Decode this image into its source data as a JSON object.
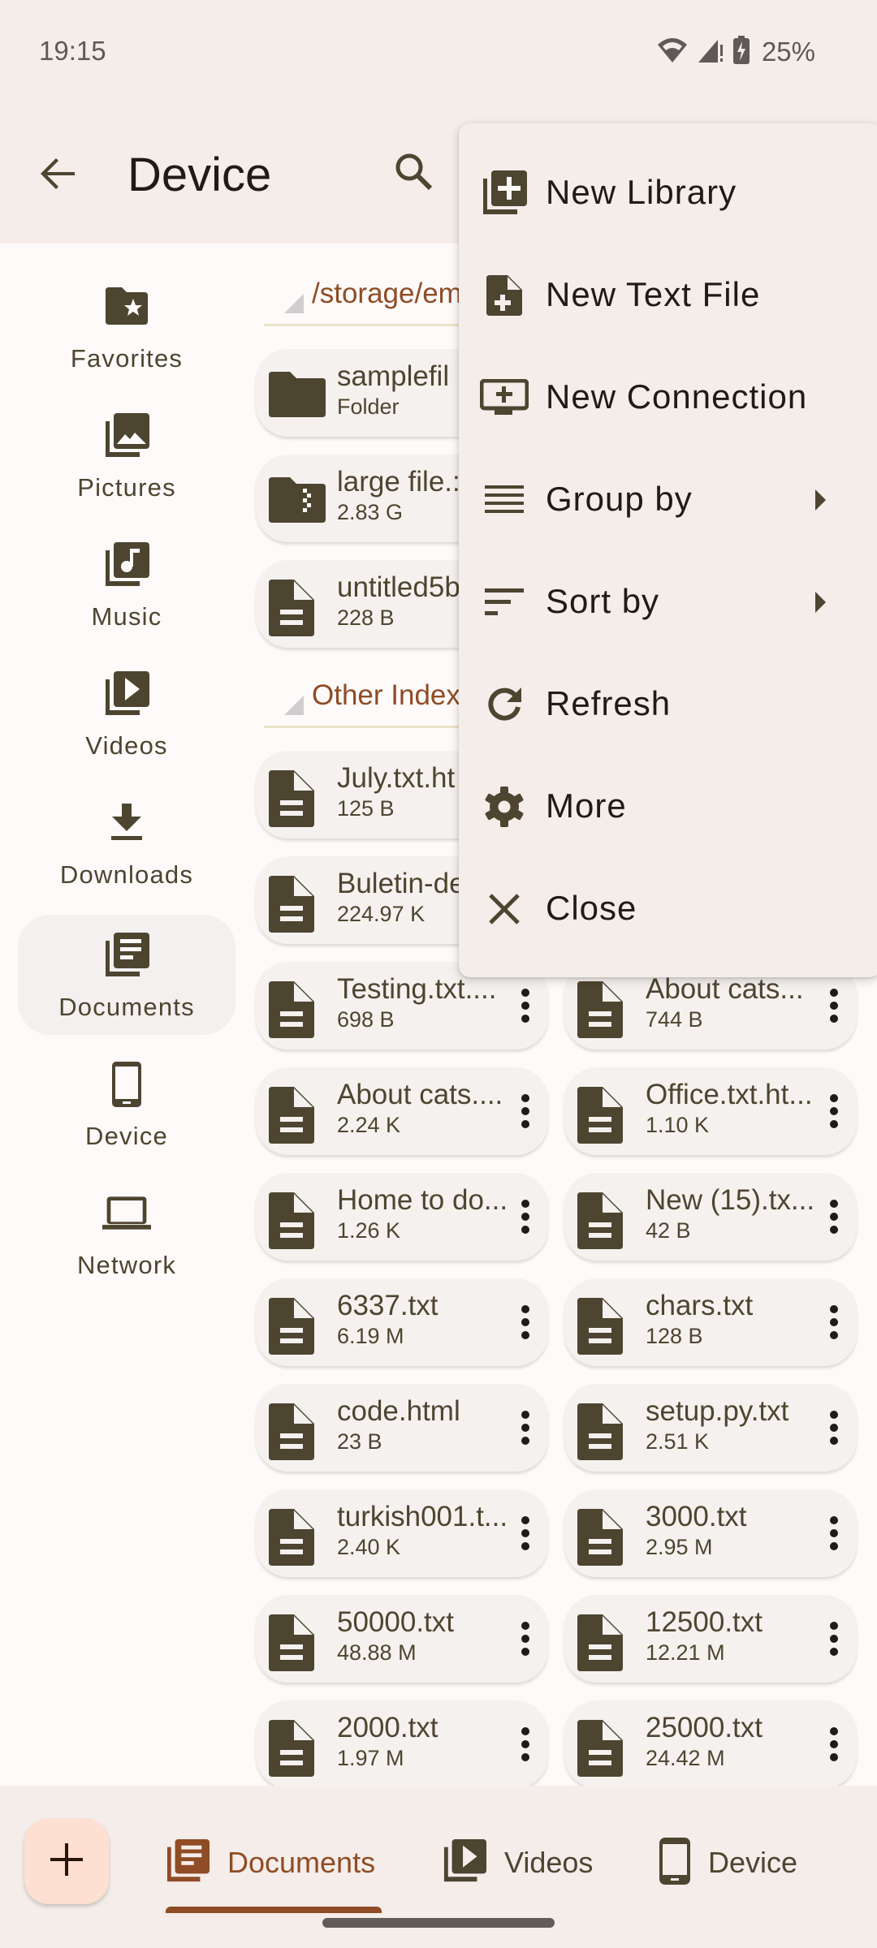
{
  "status_bar": {
    "time": "19:15",
    "battery_percent": "25%",
    "icons": [
      "wifi-icon",
      "cellular-signal-alert-icon",
      "battery-charging-icon"
    ]
  },
  "app_bar": {
    "title": "Device",
    "back_icon": "arrow-back-icon",
    "search_icon": "search-icon"
  },
  "nav_rail": {
    "items": [
      {
        "label": "Favorites",
        "icon": "folder-star-icon",
        "active": false
      },
      {
        "label": "Pictures",
        "icon": "photo-library-icon",
        "active": false
      },
      {
        "label": "Music",
        "icon": "library-music-icon",
        "active": false
      },
      {
        "label": "Videos",
        "icon": "video-library-icon",
        "active": false
      },
      {
        "label": "Downloads",
        "icon": "download-icon",
        "active": false
      },
      {
        "label": "Documents",
        "icon": "library-books-icon",
        "active": true
      },
      {
        "label": "Device",
        "icon": "smartphone-icon",
        "active": false
      },
      {
        "label": "Network",
        "icon": "laptop-icon",
        "active": false
      }
    ]
  },
  "sections": [
    {
      "title": "/storage/em",
      "files": [
        {
          "name": "samplefil",
          "size": "Folder",
          "icon": "folder-icon"
        },
        {
          "name": "large file.:",
          "size": "2.83 G",
          "icon": "folder-zip-icon"
        },
        {
          "name": "untitled5b",
          "size": "228 B",
          "icon": "text-file-icon"
        }
      ]
    },
    {
      "title": "Other Indexe",
      "files": [
        {
          "name": "July.txt.ht",
          "size": "125 B",
          "icon": "text-file-icon"
        },
        {
          "name": "Buletin-de",
          "size": "224.97 K",
          "icon": "text-file-icon"
        },
        {
          "name": "Testing.txt....",
          "size": "698 B",
          "icon": "text-file-icon"
        },
        {
          "name": "About cats...",
          "size": "744 B",
          "icon": "text-file-icon"
        },
        {
          "name": "About cats....",
          "size": "2.24 K",
          "icon": "text-file-icon"
        },
        {
          "name": "Office.txt.ht...",
          "size": "1.10 K",
          "icon": "text-file-icon"
        },
        {
          "name": "Home to do...",
          "size": "1.26 K",
          "icon": "text-file-icon"
        },
        {
          "name": "New (15).tx...",
          "size": "42 B",
          "icon": "text-file-icon"
        },
        {
          "name": "6337.txt",
          "size": "6.19 M",
          "icon": "text-file-icon"
        },
        {
          "name": "chars.txt",
          "size": "128 B",
          "icon": "text-file-icon"
        },
        {
          "name": "code.html",
          "size": "23 B",
          "icon": "text-file-icon"
        },
        {
          "name": "setup.py.txt",
          "size": "2.51 K",
          "icon": "text-file-icon"
        },
        {
          "name": "turkish001.t...",
          "size": "2.40 K",
          "icon": "text-file-icon"
        },
        {
          "name": "3000.txt",
          "size": "2.95 M",
          "icon": "text-file-icon"
        },
        {
          "name": "50000.txt",
          "size": "48.88 M",
          "icon": "text-file-icon"
        },
        {
          "name": "12500.txt",
          "size": "12.21 M",
          "icon": "text-file-icon"
        },
        {
          "name": "2000.txt",
          "size": "1.97 M",
          "icon": "text-file-icon"
        },
        {
          "name": "25000.txt",
          "size": "24.42 M",
          "icon": "text-file-icon"
        }
      ]
    }
  ],
  "popup_menu": {
    "items": [
      {
        "label": "New Library",
        "icon": "library-add-icon",
        "submenu": false
      },
      {
        "label": "New Text File",
        "icon": "note-add-icon",
        "submenu": false
      },
      {
        "label": "New Connection",
        "icon": "add-to-queue-icon",
        "submenu": false
      },
      {
        "label": "Group by",
        "icon": "group-lines-icon",
        "submenu": true
      },
      {
        "label": "Sort by",
        "icon": "sort-icon",
        "submenu": true
      },
      {
        "label": "Refresh",
        "icon": "refresh-icon",
        "submenu": false
      },
      {
        "label": "More",
        "icon": "settings-gear-icon",
        "submenu": false
      },
      {
        "label": "Close",
        "icon": "close-icon",
        "submenu": false
      }
    ]
  },
  "bottom_bar": {
    "fab_icon": "add-icon",
    "tabs": [
      {
        "label": "Documents",
        "icon": "library-books-icon",
        "active": true
      },
      {
        "label": "Videos",
        "icon": "video-library-icon",
        "active": false
      },
      {
        "label": "Device",
        "icon": "smartphone-icon",
        "active": false
      }
    ]
  },
  "colors": {
    "surface": "#f4edea",
    "background": "#fdfaf9",
    "icon": "#4d4530",
    "accent": "#8f4c25",
    "fab": "#fde0d1",
    "card": "#f5f1ef",
    "divider": "#ebe3c7"
  }
}
